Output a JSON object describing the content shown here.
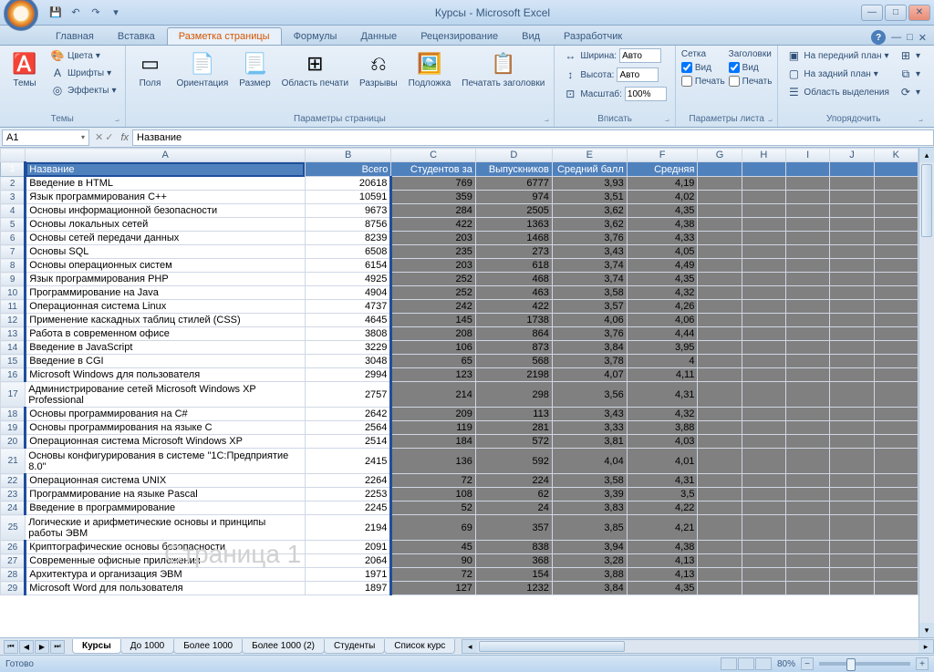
{
  "title": "Курсы - Microsoft Excel",
  "tabs": [
    "Главная",
    "Вставка",
    "Разметка страницы",
    "Формулы",
    "Данные",
    "Рецензирование",
    "Вид",
    "Разработчик"
  ],
  "active_tab": 2,
  "ribbon": {
    "themes": {
      "btn": "Темы",
      "colors": "Цвета",
      "fonts": "Шрифты",
      "effects": "Эффекты",
      "label": "Темы"
    },
    "pagesetup": {
      "margins": "Поля",
      "orientation": "Ориентация",
      "size": "Размер",
      "printarea": "Область\nпечати",
      "breaks": "Разрывы",
      "background": "Подложка",
      "printtitles": "Печатать\nзаголовки",
      "label": "Параметры страницы"
    },
    "fit": {
      "width": "Ширина:",
      "height": "Высота:",
      "scale": "Масштаб:",
      "auto": "Авто",
      "scaleval": "100%",
      "label": "Вписать"
    },
    "sheetopts": {
      "grid": "Сетка",
      "headings": "Заголовки",
      "view": "Вид",
      "print": "Печать",
      "label": "Параметры листа"
    },
    "arrange": {
      "front": "На передний план",
      "back": "На задний план",
      "selection": "Область выделения",
      "label": "Упорядочить"
    }
  },
  "namebox": "A1",
  "formula": "Название",
  "cols": [
    "A",
    "B",
    "C",
    "D",
    "E",
    "F",
    "G",
    "H",
    "I",
    "J",
    "K"
  ],
  "headers": [
    "Название",
    "Всего",
    "Студентов за",
    "Выпускников",
    "Средний балл",
    "Средняя"
  ],
  "rows": [
    {
      "n": 2,
      "a": "Введение в HTML",
      "b": "20618",
      "c": "769",
      "d": "6777",
      "e": "3,93",
      "f": "4,19"
    },
    {
      "n": 3,
      "a": "Язык программирования C++",
      "b": "10591",
      "c": "359",
      "d": "974",
      "e": "3,51",
      "f": "4,02"
    },
    {
      "n": 4,
      "a": "Основы информационной безопасности",
      "b": "9673",
      "c": "284",
      "d": "2505",
      "e": "3,62",
      "f": "4,35"
    },
    {
      "n": 5,
      "a": "Основы локальных сетей",
      "b": "8756",
      "c": "422",
      "d": "1363",
      "e": "3,62",
      "f": "4,38"
    },
    {
      "n": 6,
      "a": "Основы сетей передачи данных",
      "b": "8239",
      "c": "203",
      "d": "1468",
      "e": "3,76",
      "f": "4,33"
    },
    {
      "n": 7,
      "a": "Основы SQL",
      "b": "6508",
      "c": "235",
      "d": "273",
      "e": "3,43",
      "f": "4,05"
    },
    {
      "n": 8,
      "a": "Основы операционных систем",
      "b": "6154",
      "c": "203",
      "d": "618",
      "e": "3,74",
      "f": "4,49"
    },
    {
      "n": 9,
      "a": "Язык программирования PHP",
      "b": "4925",
      "c": "252",
      "d": "468",
      "e": "3,74",
      "f": "4,35"
    },
    {
      "n": 10,
      "a": "Программирование на Java",
      "b": "4904",
      "c": "252",
      "d": "463",
      "e": "3,58",
      "f": "4,32"
    },
    {
      "n": 11,
      "a": "Операционная система Linux",
      "b": "4737",
      "c": "242",
      "d": "422",
      "e": "3,57",
      "f": "4,26"
    },
    {
      "n": 12,
      "a": "Применение каскадных таблиц стилей (CSS)",
      "b": "4645",
      "c": "145",
      "d": "1738",
      "e": "4,06",
      "f": "4,06"
    },
    {
      "n": 13,
      "a": "Работа в современном офисе",
      "b": "3808",
      "c": "208",
      "d": "864",
      "e": "3,76",
      "f": "4,44"
    },
    {
      "n": 14,
      "a": "Введение в JavaScript",
      "b": "3229",
      "c": "106",
      "d": "873",
      "e": "3,84",
      "f": "3,95"
    },
    {
      "n": 15,
      "a": "Введение в CGI",
      "b": "3048",
      "c": "65",
      "d": "568",
      "e": "3,78",
      "f": "4"
    },
    {
      "n": 16,
      "a": "Microsoft Windows для пользователя",
      "b": "2994",
      "c": "123",
      "d": "2198",
      "e": "4,07",
      "f": "4,11"
    },
    {
      "n": 17,
      "a": "Администрирование сетей Microsoft Windows XP Professional",
      "b": "2757",
      "c": "214",
      "d": "298",
      "e": "3,56",
      "f": "4,31",
      "tall": true
    },
    {
      "n": 18,
      "a": "Основы программирования на C#",
      "b": "2642",
      "c": "209",
      "d": "113",
      "e": "3,43",
      "f": "4,32"
    },
    {
      "n": 19,
      "a": "Основы программирования на языке C",
      "b": "2564",
      "c": "119",
      "d": "281",
      "e": "3,33",
      "f": "3,88"
    },
    {
      "n": 20,
      "a": "Операционная система Microsoft Windows XP",
      "b": "2514",
      "c": "184",
      "d": "572",
      "e": "3,81",
      "f": "4,03"
    },
    {
      "n": 21,
      "a": "Основы конфигурирования в системе \"1C:Предприятие 8.0\"",
      "b": "2415",
      "c": "136",
      "d": "592",
      "e": "4,04",
      "f": "4,01",
      "tall": true
    },
    {
      "n": 22,
      "a": "Операционная система UNIX",
      "b": "2264",
      "c": "72",
      "d": "224",
      "e": "3,58",
      "f": "4,31"
    },
    {
      "n": 23,
      "a": "Программирование на языке Pascal",
      "b": "2253",
      "c": "108",
      "d": "62",
      "e": "3,39",
      "f": "3,5"
    },
    {
      "n": 24,
      "a": "Введение в программирование",
      "b": "2245",
      "c": "52",
      "d": "24",
      "e": "3,83",
      "f": "4,22"
    },
    {
      "n": 25,
      "a": "Логические и арифметические основы и принципы работы ЭВМ",
      "b": "2194",
      "c": "69",
      "d": "357",
      "e": "3,85",
      "f": "4,21",
      "tall": true
    },
    {
      "n": 26,
      "a": "Криптографические основы безопасности",
      "b": "2091",
      "c": "45",
      "d": "838",
      "e": "3,94",
      "f": "4,38"
    },
    {
      "n": 27,
      "a": "Современные офисные приложения",
      "b": "2064",
      "c": "90",
      "d": "368",
      "e": "3,28",
      "f": "4,13"
    },
    {
      "n": 28,
      "a": "Архитектура и организация ЭВМ",
      "b": "1971",
      "c": "72",
      "d": "154",
      "e": "3,88",
      "f": "4,13"
    },
    {
      "n": 29,
      "a": "Microsoft Word для пользователя",
      "b": "1897",
      "c": "127",
      "d": "1232",
      "e": "3,84",
      "f": "4,35"
    }
  ],
  "sheets": [
    "Курсы",
    "До 1000",
    "Более 1000",
    "Более 1000 (2)",
    "Студенты",
    "Список курс"
  ],
  "active_sheet": 0,
  "status": "Готово",
  "zoom": "80%",
  "watermark": "Страница 1"
}
